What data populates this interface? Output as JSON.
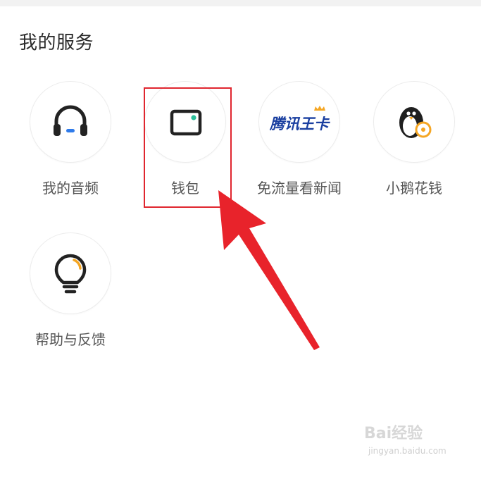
{
  "section": {
    "title": "我的服务"
  },
  "services": [
    {
      "label": "我的音频",
      "icon": "headphones-icon"
    },
    {
      "label": "钱包",
      "icon": "wallet-icon"
    },
    {
      "label": "免流量看新闻",
      "icon": "tencent-king-card-icon",
      "logo_text": "腾讯王卡"
    },
    {
      "label": "小鹅花钱",
      "icon": "penguin-coin-icon"
    },
    {
      "label": "帮助与反馈",
      "icon": "lightbulb-icon"
    }
  ],
  "colors": {
    "accent_teal": "#2bbf9a",
    "accent_blue": "#2f7bea",
    "accent_orange": "#f5a623",
    "annotation_red": "#e0262f"
  },
  "watermark": {
    "brand": "Bai经验",
    "site": "jingyan.baidu.com"
  }
}
